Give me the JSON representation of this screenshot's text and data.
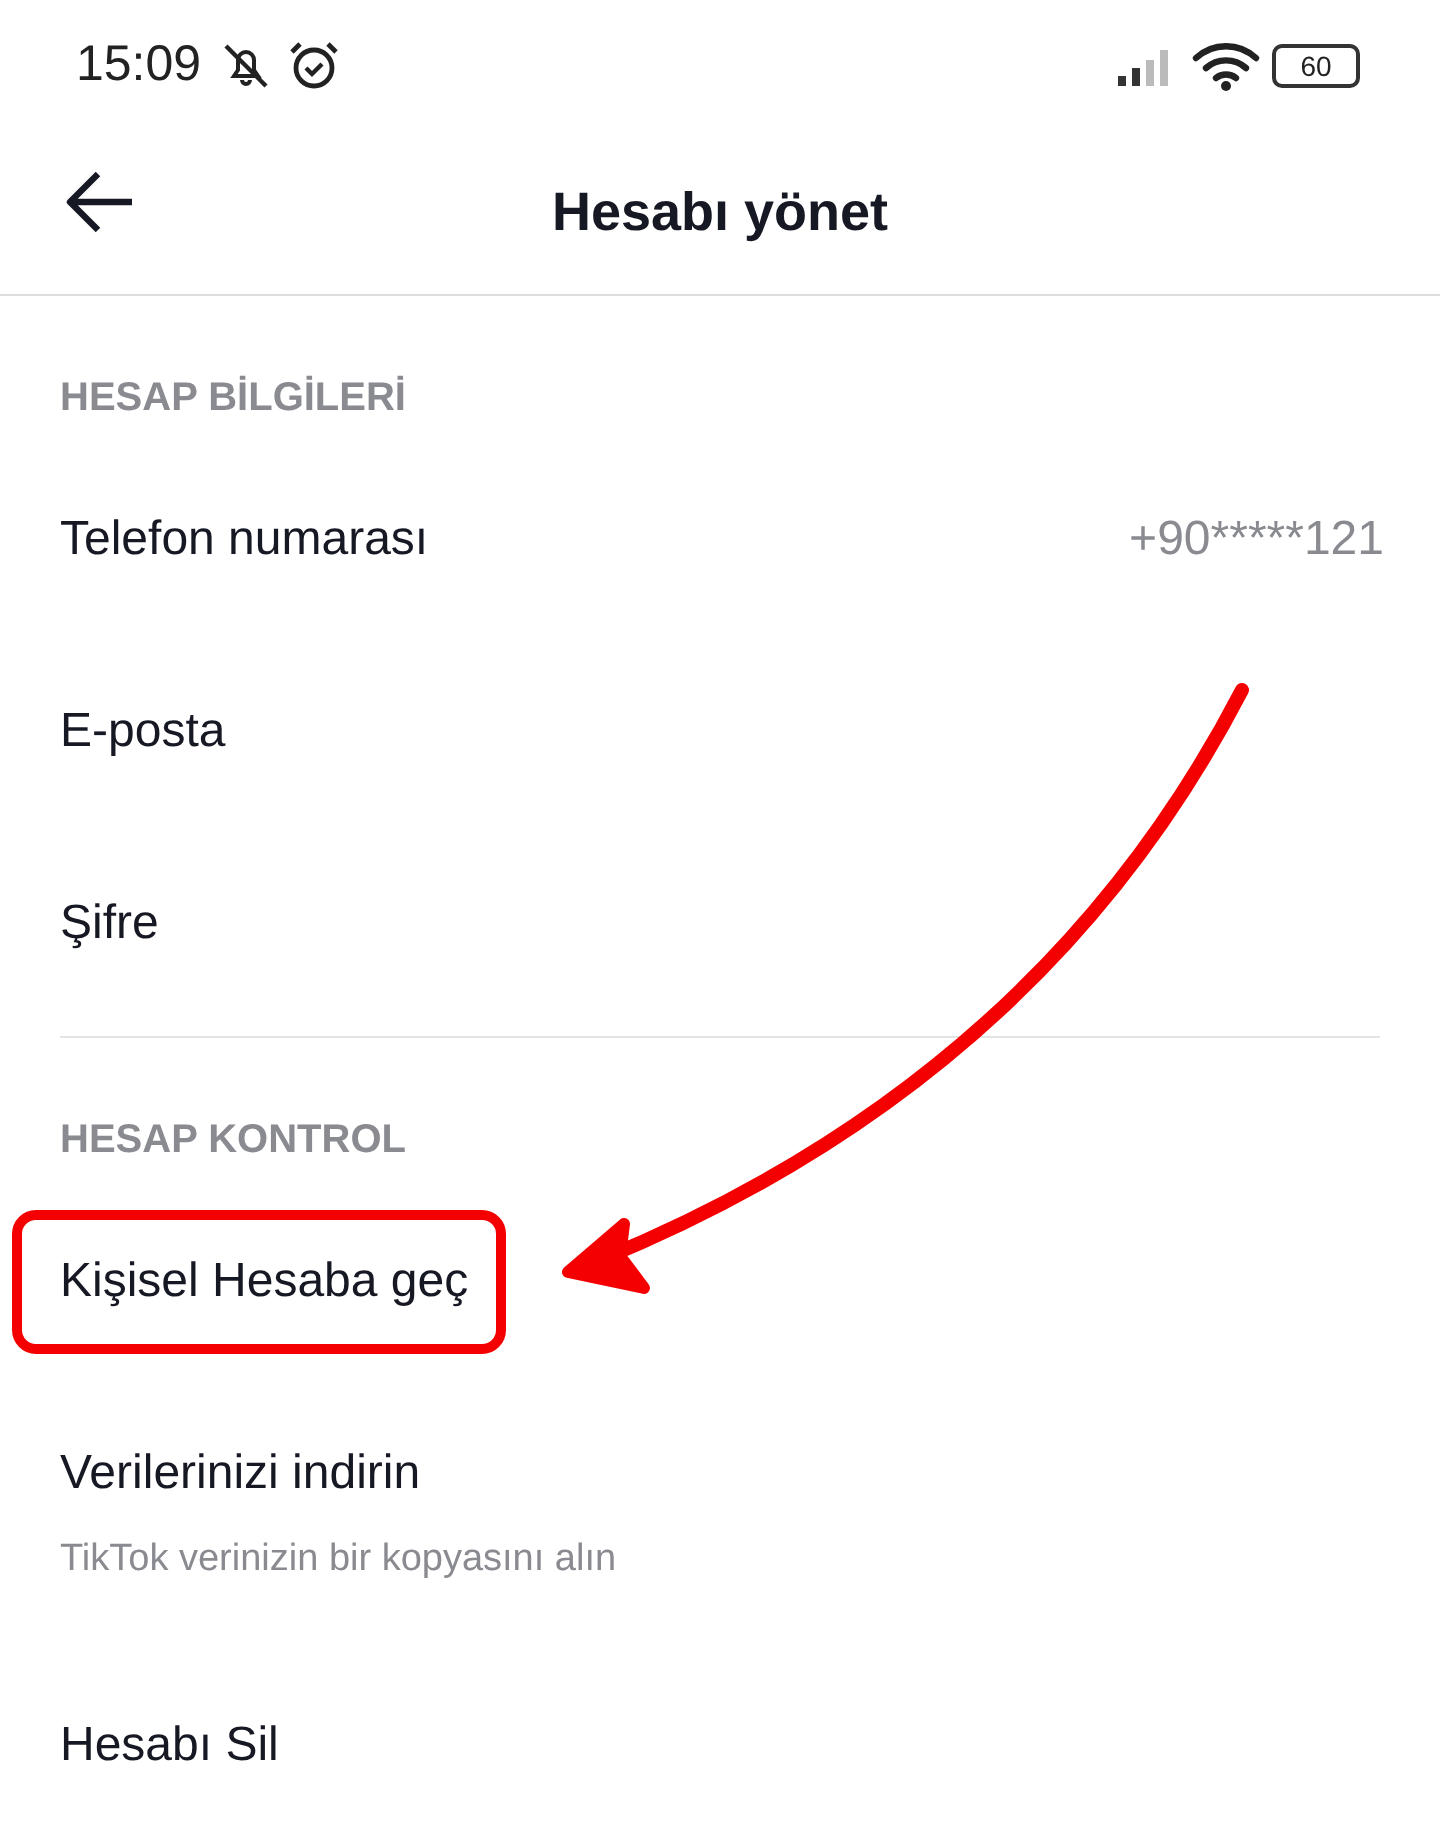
{
  "status_bar": {
    "time": "15:09",
    "battery": "60"
  },
  "header": {
    "title": "Hesabı yönet"
  },
  "sections": [
    {
      "title": "HESAP BİLGİLERİ",
      "items": [
        {
          "label": "Telefon numarası",
          "value": "+90*****121",
          "highlighted": false
        },
        {
          "label": "E-posta",
          "highlighted": false
        },
        {
          "label": "Şifre",
          "highlighted": false
        }
      ]
    },
    {
      "title": "HESAP KONTROL",
      "items": [
        {
          "label": "Kişisel Hesaba geç",
          "highlighted": true
        },
        {
          "label": "Verilerinizi indirin",
          "subtitle": "TikTok verinizin bir kopyasını alın",
          "highlighted": false
        },
        {
          "label": "Hesabı Sil",
          "highlighted": false
        }
      ]
    }
  ]
}
